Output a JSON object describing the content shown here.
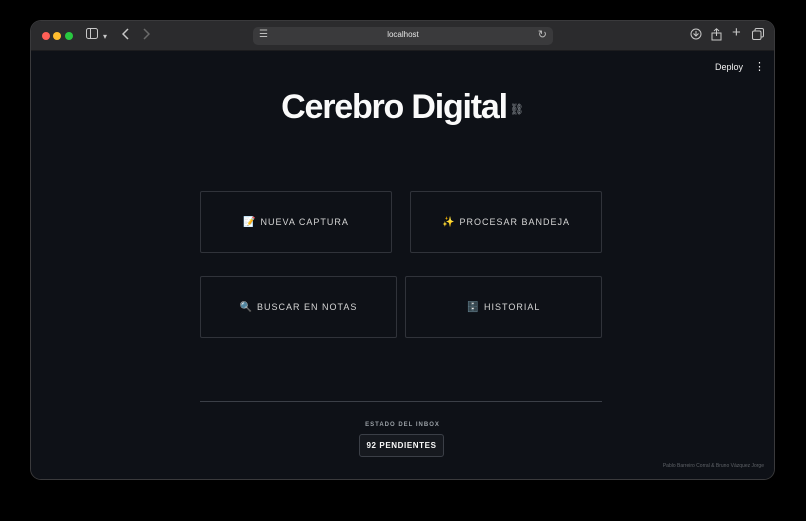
{
  "browser": {
    "url": "localhost"
  },
  "toolbar": {
    "deploy_label": "Deploy"
  },
  "page": {
    "title": "Cerebro Digital"
  },
  "cards": [
    {
      "emoji": "📝",
      "label": "NUEVA CAPTURA"
    },
    {
      "emoji": "✨",
      "label": "PROCESAR BANDEJA"
    },
    {
      "emoji": "🔍",
      "label": "BUSCAR EN NOTAS"
    },
    {
      "emoji": "🗄️",
      "label": "HISTORIAL"
    }
  ],
  "inbox": {
    "label": "ESTADO DEL INBOX",
    "count_label": "92 PENDIENTES"
  },
  "footer": {
    "credits": "Pablo Barreiro Corral & Bruno Vázquez Jorge"
  },
  "colors": {
    "background": "#0e1117",
    "card_border": "#30333a",
    "text": "#fafafa"
  }
}
